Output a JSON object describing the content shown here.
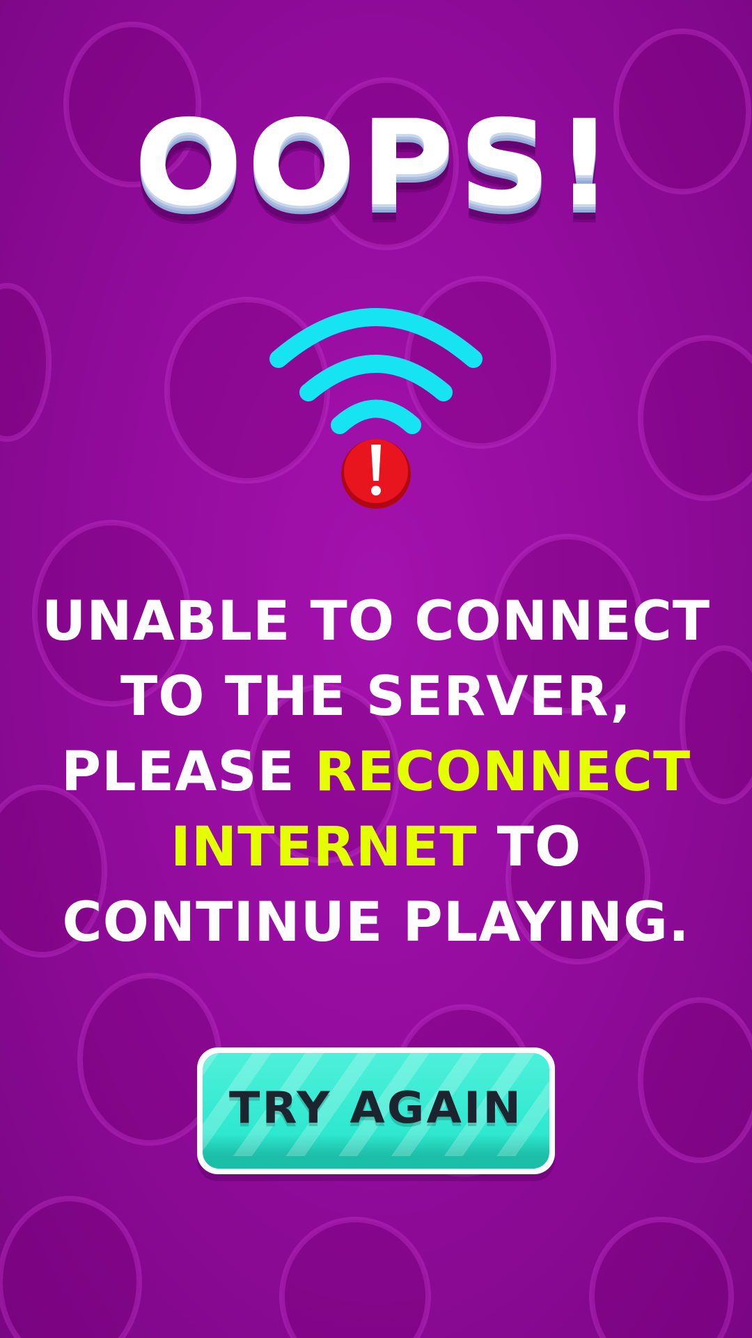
{
  "title": "OOPS!",
  "message": {
    "line1": "UNABLE TO CONNECT",
    "line2": "TO THE SERVER,",
    "line3_prefix": "PLEASE ",
    "line3_highlight": "RECONNECT",
    "line4_highlight": "INTERNET",
    "line4_suffix": " TO",
    "line5": "CONTINUE PLAYING."
  },
  "button": {
    "label": "TRY AGAIN"
  },
  "icons": {
    "wifi": "wifi-icon",
    "alert": "exclamation-icon"
  },
  "colors": {
    "background": "#9c0ea6",
    "highlight": "#e4ff00",
    "wifi": "#16e4f3",
    "alert": "#e8141e",
    "button": "#2ee8cf"
  }
}
